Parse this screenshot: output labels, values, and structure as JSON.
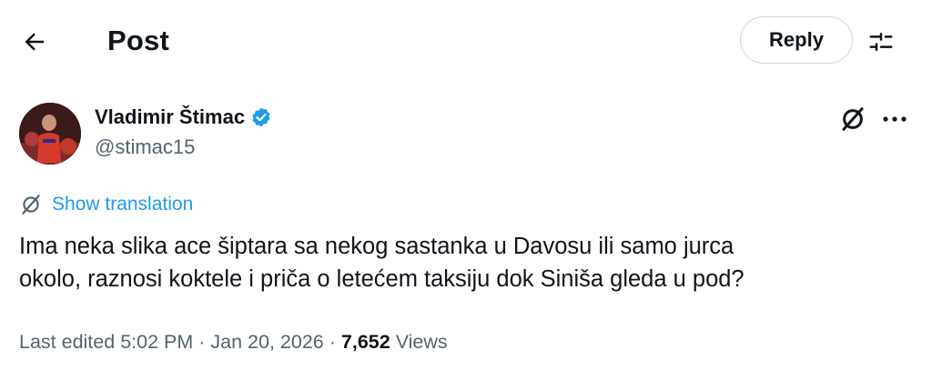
{
  "header": {
    "title": "Post",
    "reply_label": "Reply"
  },
  "author": {
    "display_name": "Vladimir Štimac",
    "handle": "@stimac15",
    "verified": true,
    "verified_color": "#1d9bf0"
  },
  "translate": {
    "label": "Show translation"
  },
  "post": {
    "text": "Ima neka slika ace šiptara sa nekog sastanka u Davosu ili samo jurca\nokolo, raznosi koktele i priča o letećem taksiju dok Siniša gleda u pod?"
  },
  "meta": {
    "edited_label": "Last edited",
    "time": "5:02 PM",
    "separator": "·",
    "date": "Jan 20, 2026",
    "views_count": "7,652",
    "views_label": "Views"
  },
  "icons": {
    "back": "arrow-left-icon",
    "filter": "sliders-icon",
    "verified": "verified-badge-icon",
    "grok": "grok-icon",
    "more": "more-dots-icon",
    "translate": "translate-icon"
  },
  "colors": {
    "text": "#0f1419",
    "secondary": "#536471",
    "link": "#1d9bf0",
    "border": "#cfd9de"
  }
}
